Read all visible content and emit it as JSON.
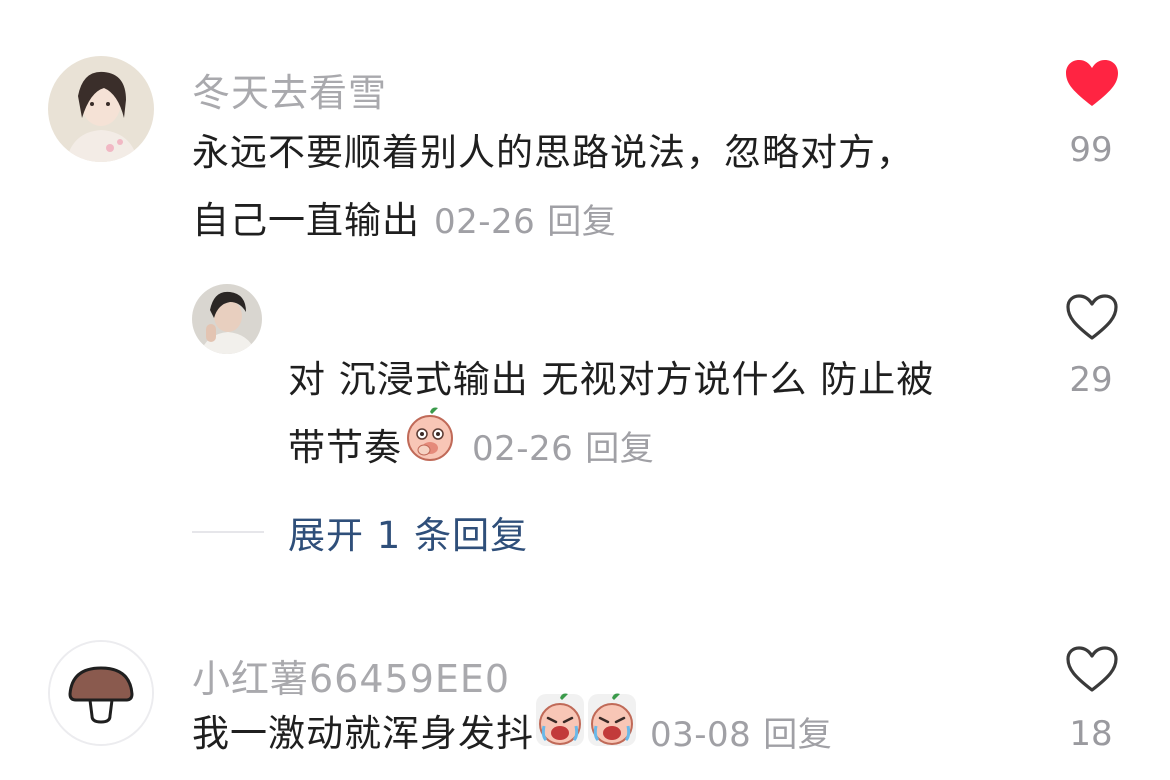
{
  "comments": [
    {
      "username": "冬天去看雪",
      "text": "永远不要顺着别人的思路说法，忽略对方，自己一直输出",
      "line1": "永远不要顺着别人的思路说法，忽略对方，",
      "line2": "自己一直输出",
      "date": "02-26",
      "reply_label": "回复",
      "likes": "99",
      "liked": true,
      "avatar_icon": "profile-photo-icon"
    },
    {
      "username": "",
      "text": "对 沉浸式输出 无视对方说什么 防止被带节奏",
      "line1": "对 沉浸式输出 无视对方说什么 防止被",
      "line2": "带节奏",
      "date": "02-26",
      "reply_label": "回复",
      "likes": "29",
      "liked": false,
      "avatar_icon": "profile-photo-icon",
      "emoji": "peach-emoji-icon"
    },
    {
      "username": "小红薯66459EE0",
      "text": "我一激动就浑身发抖",
      "date": "03-08",
      "reply_label": "回复",
      "likes": "18",
      "liked": false,
      "avatar_icon": "mushroom-icon",
      "emoji": "crying-peach-emoji-icon"
    }
  ],
  "expand_replies": {
    "label": "展开 1 条回复"
  },
  "colors": {
    "liked_heart": "#ff2442",
    "username": "#a9a9ad",
    "expand_link": "#2f4f7a"
  }
}
